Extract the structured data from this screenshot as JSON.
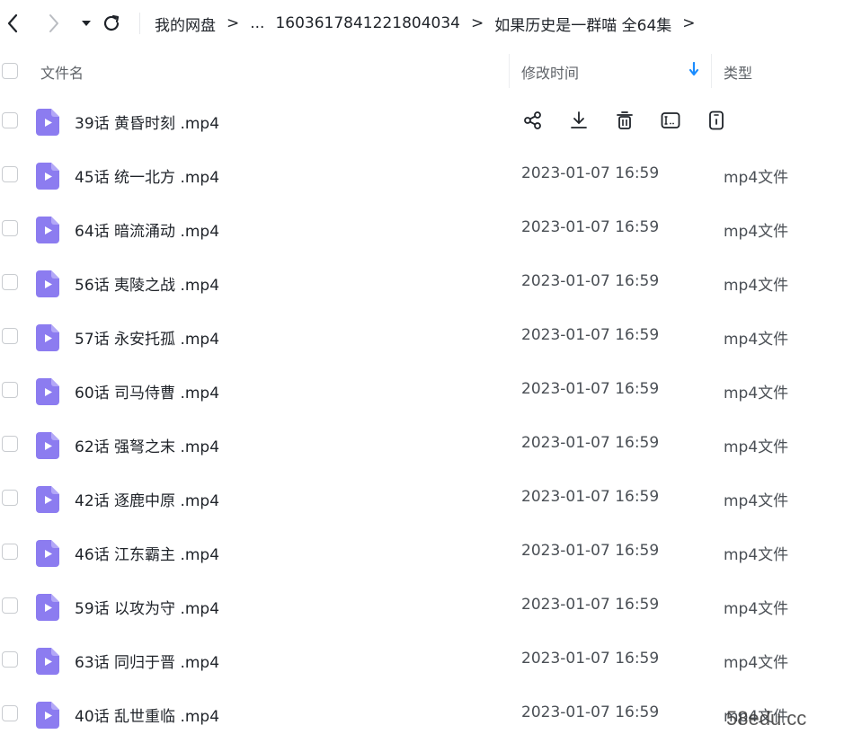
{
  "breadcrumb": {
    "items": [
      "我的网盘",
      "...",
      "1603617841221804034",
      "如果历史是一群喵 全64集"
    ],
    "separator": ">"
  },
  "table": {
    "columns": {
      "name": "文件名",
      "modified": "修改时间",
      "type": "类型"
    },
    "sort_indicator_color": "#1a8cff",
    "rows": [
      {
        "name": "39话 黄昏时刻 .mp4",
        "modified": "",
        "type": "",
        "hovered": true
      },
      {
        "name": "45话 统一北方 .mp4",
        "modified": "2023-01-07 16:59",
        "type": "mp4文件"
      },
      {
        "name": "64话 暗流涌动 .mp4",
        "modified": "2023-01-07 16:59",
        "type": "mp4文件"
      },
      {
        "name": "56话 夷陵之战 .mp4",
        "modified": "2023-01-07 16:59",
        "type": "mp4文件"
      },
      {
        "name": "57话 永安托孤 .mp4",
        "modified": "2023-01-07 16:59",
        "type": "mp4文件"
      },
      {
        "name": "60话 司马侍曹 .mp4",
        "modified": "2023-01-07 16:59",
        "type": "mp4文件"
      },
      {
        "name": "62话 强弩之末 .mp4",
        "modified": "2023-01-07 16:59",
        "type": "mp4文件"
      },
      {
        "name": "42话 逐鹿中原 .mp4",
        "modified": "2023-01-07 16:59",
        "type": "mp4文件"
      },
      {
        "name": "46话 江东霸主 .mp4",
        "modified": "2023-01-07 16:59",
        "type": "mp4文件"
      },
      {
        "name": "59话 以攻为守 .mp4",
        "modified": "2023-01-07 16:59",
        "type": "mp4文件"
      },
      {
        "name": "63话 同归于晋 .mp4",
        "modified": "2023-01-07 16:59",
        "type": "mp4文件"
      },
      {
        "name": "40话 乱世重临 .mp4",
        "modified": "2023-01-07 16:59",
        "type": "mp4文件"
      }
    ],
    "row_actions": [
      "share-icon",
      "download-icon",
      "delete-icon",
      "rename-icon",
      "details-icon"
    ]
  },
  "file_icon_color": "#8c7cf0",
  "watermark": "58edu.cc"
}
